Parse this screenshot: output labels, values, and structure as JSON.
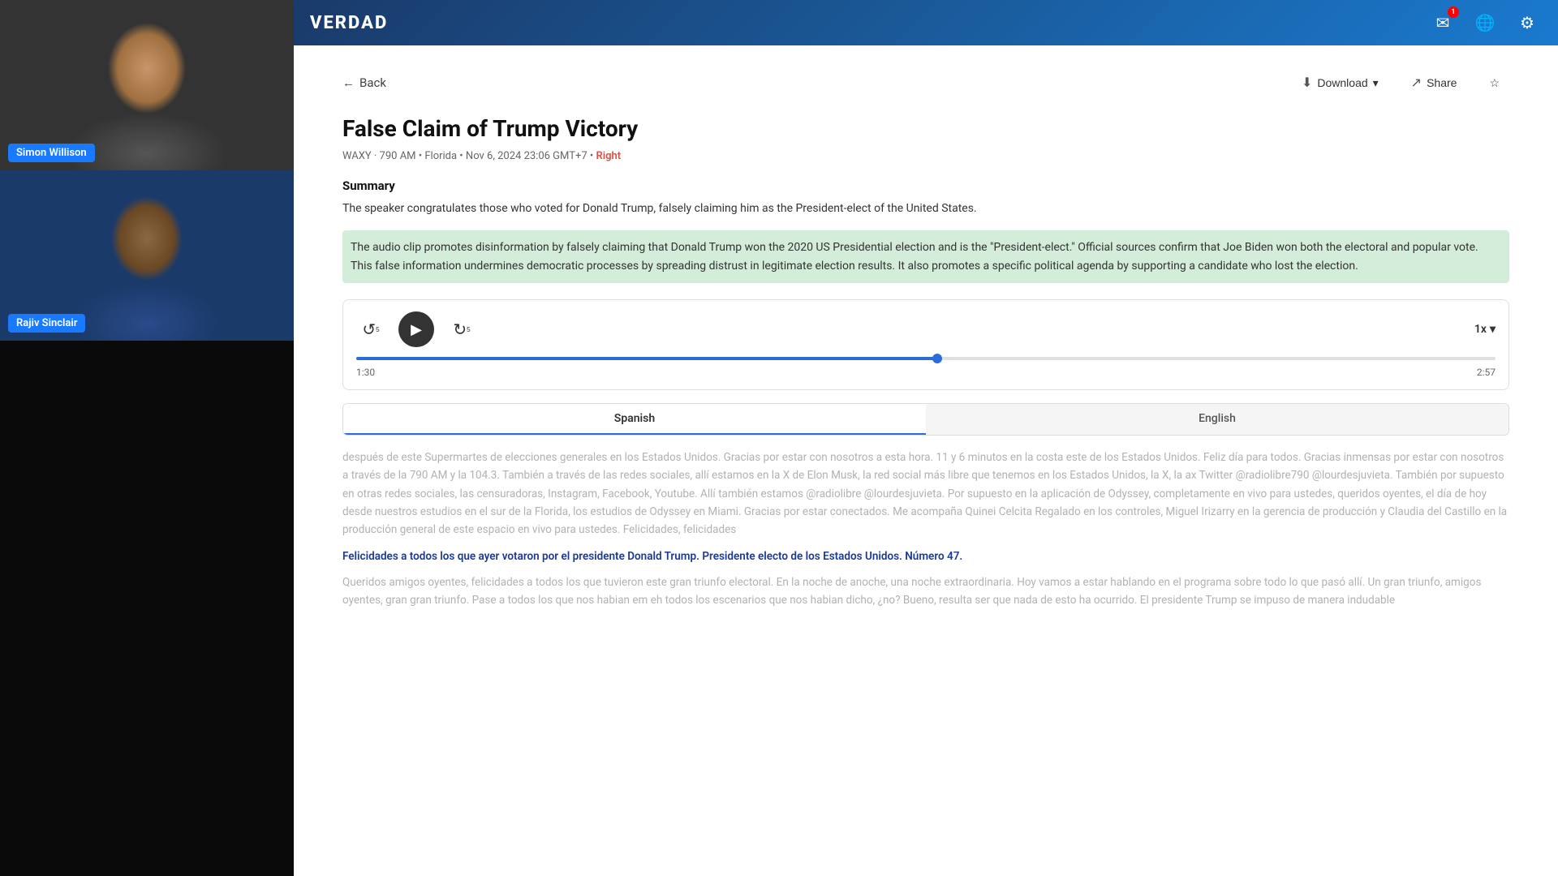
{
  "brand": "VERDAD",
  "navbar": {
    "notification_badge": "1",
    "icons": [
      "bell",
      "globe",
      "settings"
    ]
  },
  "back_label": "Back",
  "actions": {
    "download": "Download",
    "share": "Share"
  },
  "article": {
    "title": "False Claim of Trump Victory",
    "meta": "WAXY · 790 AM • Florida • Nov 6, 2024 23:06 GMT+7 •",
    "bias": "Right",
    "summary_heading": "Summary",
    "summary_text": "The speaker congratulates those who voted for Donald Trump, falsely claiming him as the President-elect of the United States.",
    "highlight": "The audio clip promotes disinformation by falsely claiming that Donald Trump won the 2020 US Presidential election and is the \"President-elect.\" Official sources confirm that Joe Biden won both the electoral and popular vote. This false information undermines democratic processes by spreading distrust in legitimate election results. It also promotes a specific political agenda by supporting a candidate who lost the election."
  },
  "player": {
    "current_time": "1:30",
    "total_time": "2:57",
    "progress_percent": 51,
    "speed": "1x"
  },
  "tabs": {
    "spanish": "Spanish",
    "english": "English",
    "active": "Spanish"
  },
  "transcript": {
    "main": "después de este Supermartes de elecciones generales en los Estados Unidos. Gracias por estar con nosotros a esta hora. 11 y 6 minutos en la costa este de los Estados Unidos. Feliz día para todos. Gracias inmensas por estar con nosotros a través de la 790 AM y la 104.3. También a través de las redes sociales, allí estamos en la X de Elon Musk, la red social más libre que tenemos en los Estados Unidos, la X, la ax Twitter @radiolibre790 @lourdesjuvieta. También por supuesto en otras redes sociales, las censuradoras, Instagram, Facebook, Youtube. Allí también estamos @radiolibre @lourdesjuvieta. Por supuesto en la aplicación de Odyssey, completamente en vivo para ustedes, queridos oyentes, el día de hoy desde nuestros estudios en el sur de la Florida, los estudios de Odyssey en Miami. Gracias por estar conectados. Me acompaña Quinei Celcita Regalado en los controles, Miguel Irizarry en la gerencia de producción y Claudia del Castillo en la producción general de este espacio en vivo para ustedes. Felicidades, felicidades",
    "highlighted": "Felicidades a todos los que ayer votaron por el presidente Donald Trump. Presidente electo de los Estados Unidos. Número 47.",
    "after": "Queridos amigos oyentes, felicidades a todos los que tuvieron este gran triunfo electoral. En la noche de anoche, una noche extraordinaria. Hoy vamos a estar hablando en el programa sobre todo lo que pasó allí. Un gran triunfo, amigos oyentes, gran gran triunfo. Pase a todos los que nos habian em eh todos los escenarios que nos habian dicho, ¿no? Bueno, resulta ser que nada de esto ha ocurrido. El presidente Trump se impuso de manera indudable"
  },
  "video_tiles": [
    {
      "name": "Simon Willison",
      "position": "top"
    },
    {
      "name": "Rajiv Sinclair",
      "position": "bottom"
    }
  ]
}
